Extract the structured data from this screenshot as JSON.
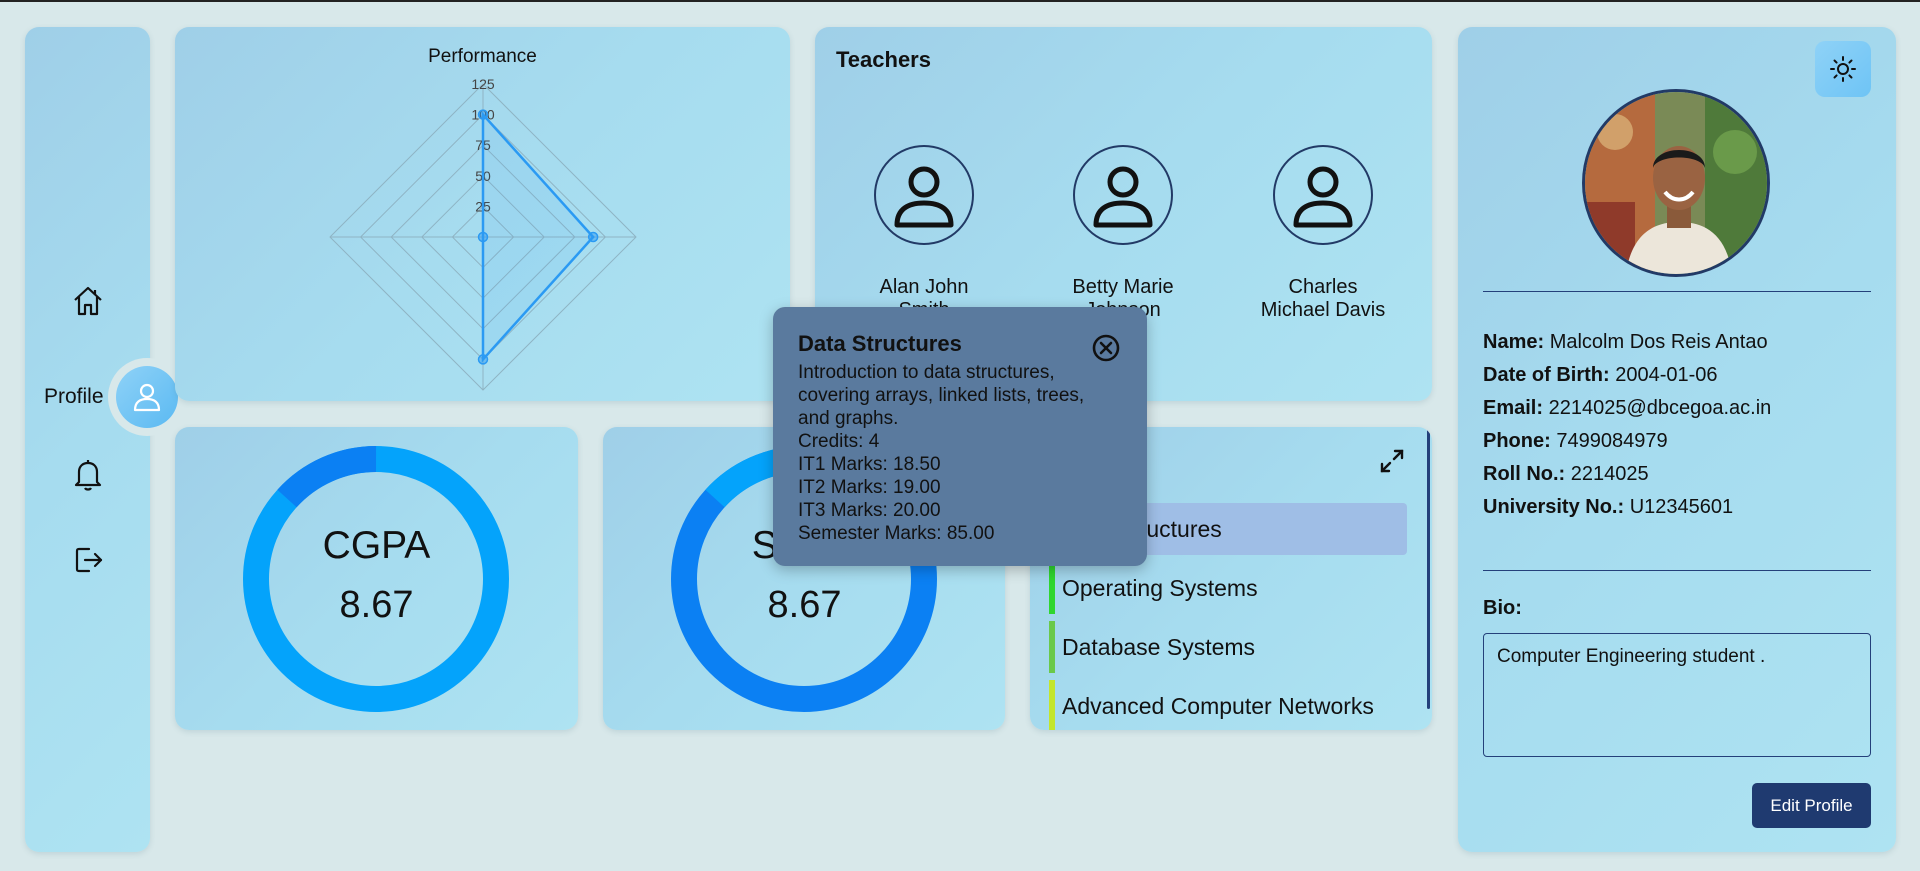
{
  "sidebar": {
    "profile_label": "Profile",
    "icons": [
      "home-icon",
      "user-icon",
      "bell-icon",
      "logout-icon"
    ]
  },
  "performance": {
    "title": "Performance",
    "chart_data": {
      "type": "radar",
      "title": "Performance",
      "axes_count": 4,
      "ticks": [
        "125",
        "100",
        "75",
        "50",
        "25"
      ],
      "rlim": [
        0,
        125
      ],
      "series": [
        {
          "values": [
            100,
            90,
            100,
            0
          ],
          "color": "#2b9af3"
        }
      ],
      "grid": true
    }
  },
  "teachers": {
    "title": "Teachers",
    "list": [
      {
        "name_line1": "Alan John",
        "name_line2": "Smith"
      },
      {
        "name_line1": "Betty Marie",
        "name_line2": "Johnson"
      },
      {
        "name_line1": "Charles",
        "name_line2": "Michael Davis"
      }
    ]
  },
  "cgpa": {
    "label": "CGPA",
    "value": "8.67",
    "chart_data": {
      "type": "pie",
      "values": [
        8.67,
        1.33
      ],
      "colors": [
        "#04a3fb",
        "#0b80f3"
      ]
    }
  },
  "sgpa": {
    "label": "SGPA",
    "value": "8.67",
    "chart_data": {
      "type": "pie",
      "values": [
        8.67,
        1.33
      ],
      "colors": [
        "#0b80f3",
        "#04a3fb"
      ]
    }
  },
  "subjects": {
    "items": [
      {
        "name": "Data Structures",
        "color": "#4f8fd6"
      },
      {
        "name": "Operating Systems",
        "color": "#2fd62f"
      },
      {
        "name": "Database Systems",
        "color": "#6ac94a"
      },
      {
        "name": "Advanced Computer Networks",
        "color": "#c3e62c"
      }
    ]
  },
  "tooltip": {
    "title": "Data Structures",
    "description_lines": [
      "Introduction to data structures,",
      "covering arrays, linked lists, trees,",
      "and graphs."
    ],
    "credits": "Credits: 4",
    "it1": "IT1 Marks: 18.50",
    "it2": "IT2 Marks: 19.00",
    "it3": "IT3 Marks: 20.00",
    "semester": "Semester Marks: 85.00"
  },
  "profile": {
    "name_label": "Name:",
    "name": "Malcolm Dos Reis Antao",
    "dob_label": "Date of Birth:",
    "dob": "2004-01-06",
    "email_label": "Email:",
    "email": "2214025@dbcegoa.ac.in",
    "phone_label": "Phone:",
    "phone": "7499084979",
    "roll_label": "Roll No.:",
    "roll": "2214025",
    "univ_label": "University No.:",
    "univ": "U12345601",
    "bio_label": "Bio:",
    "bio": "Computer Engineering student .",
    "edit_button": "Edit Profile"
  },
  "colors": {
    "accent": "#0b80f3",
    "dark_blue": "#1f3a70",
    "tooltip_bg": "#5a7a9e"
  }
}
